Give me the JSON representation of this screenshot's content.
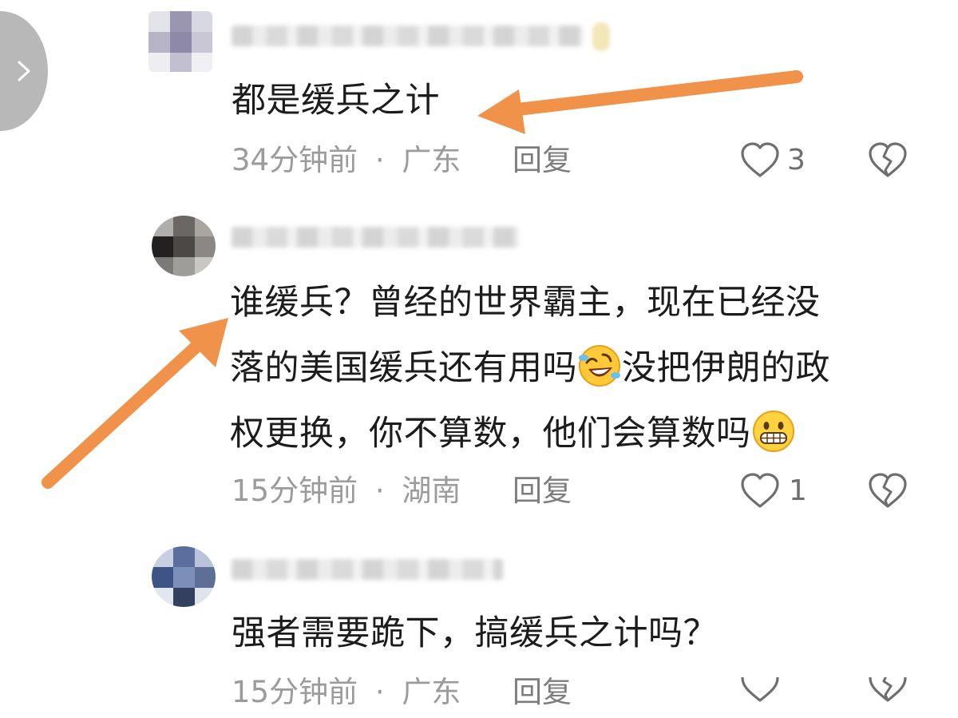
{
  "comments": [
    {
      "text_lines": [
        "都是缓兵之计"
      ],
      "time": "34分钟前",
      "sep": "·",
      "location": "广东",
      "reply_label": "回复",
      "like_count": "3"
    },
    {
      "text_lines": [
        "谁缓兵？曾经的世界霸主，现在已经没",
        "落的美国缓兵还有用吗",
        "没把伊朗的政",
        "权更换，你不算数，他们会算数吗"
      ],
      "time": "15分钟前",
      "sep": "·",
      "location": "湖南",
      "reply_label": "回复",
      "like_count": "1"
    },
    {
      "text_lines": [
        "强者需要跪下，搞缓兵之计吗？"
      ],
      "time": "15分钟前",
      "sep": "·",
      "location": "广东",
      "reply_label": "回复",
      "like_count": ""
    }
  ],
  "icons": {
    "like": "heart-outline-icon",
    "dislike": "broken-heart-icon",
    "side": "chevron-right-icon",
    "emoji_1": "rolling-laughing-emoji",
    "emoji_2": "grinning-emoji"
  },
  "colors": {
    "arrow": "#f0924a",
    "text": "#1c1c1c",
    "meta": "#9b9b9b",
    "icon": "#6e6e6e"
  }
}
